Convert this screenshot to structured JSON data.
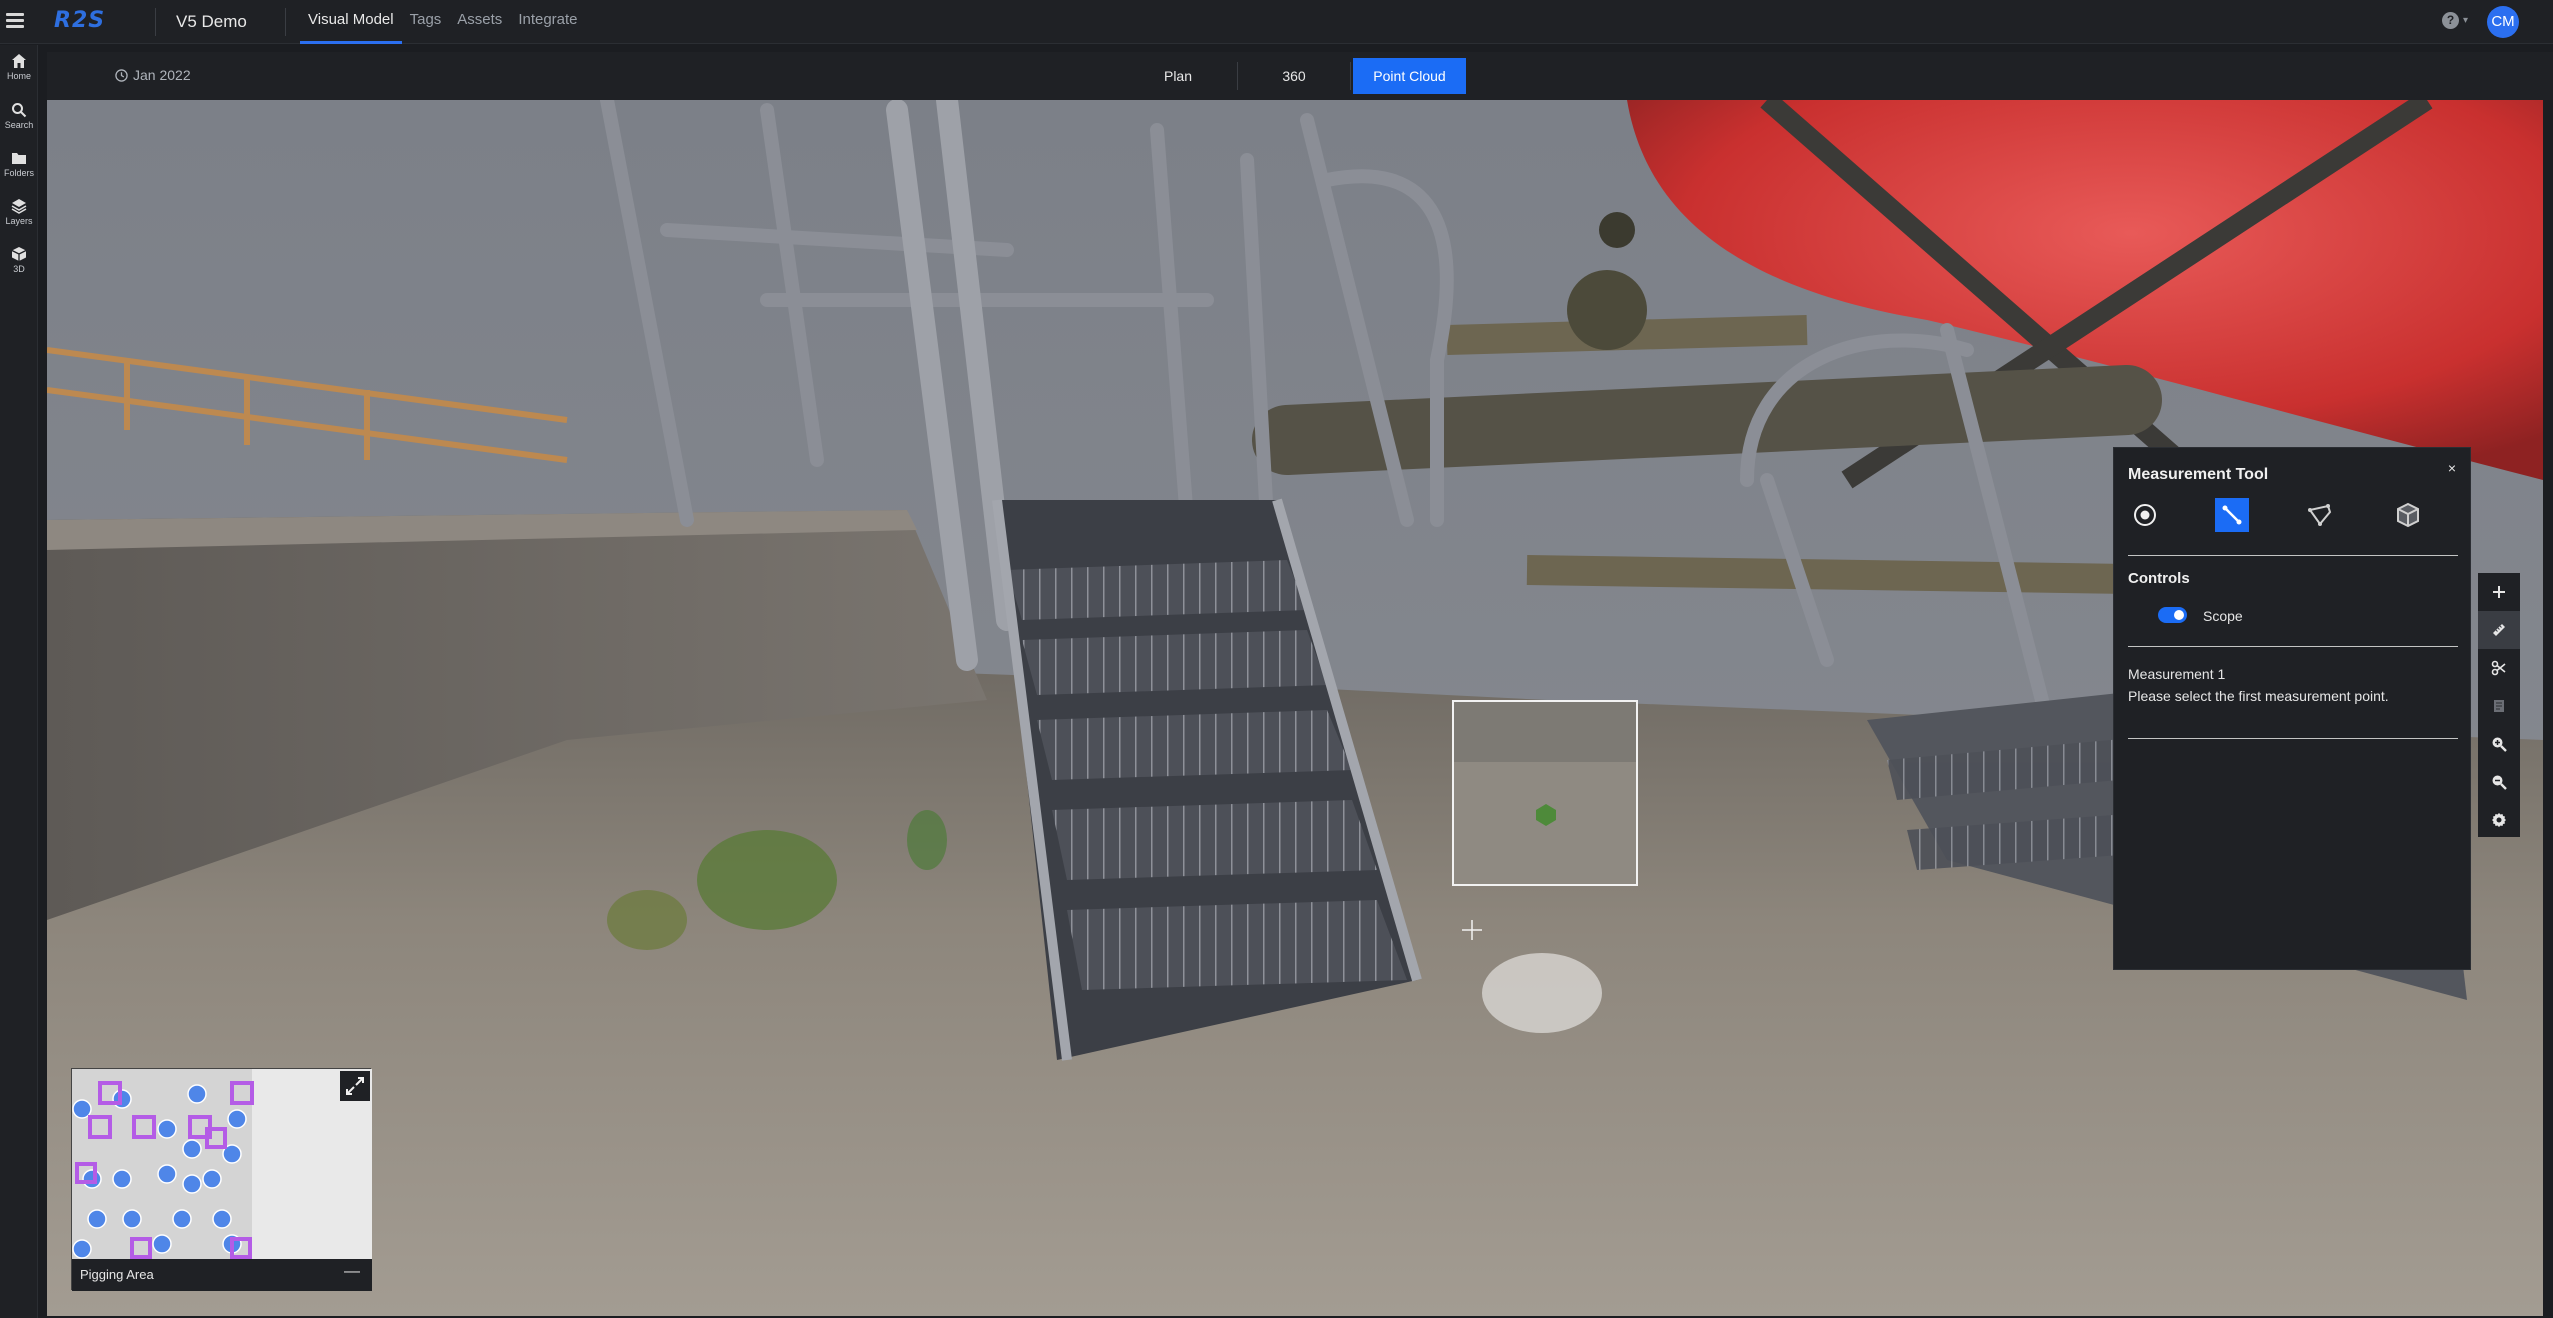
{
  "topbar": {
    "logo": "R2S",
    "project": "V5 Demo",
    "tabs": [
      {
        "label": "Visual Model",
        "active": true
      },
      {
        "label": "Tags",
        "active": false
      },
      {
        "label": "Assets",
        "active": false
      },
      {
        "label": "Integrate",
        "active": false
      }
    ],
    "help": "?",
    "avatar": "CM"
  },
  "sidebar": {
    "items": [
      {
        "label": "Home",
        "icon": "home-icon"
      },
      {
        "label": "Search",
        "icon": "search-icon"
      },
      {
        "label": "Folders",
        "icon": "folder-icon"
      },
      {
        "label": "Layers",
        "icon": "layers-icon"
      },
      {
        "label": "3D",
        "icon": "cube-icon"
      }
    ]
  },
  "subbar": {
    "date": "Jan 2022",
    "views": [
      {
        "label": "Plan",
        "active": false
      },
      {
        "label": "360",
        "active": false
      },
      {
        "label": "Point Cloud",
        "active": true
      }
    ]
  },
  "minimap": {
    "title": "Pigging Area",
    "minimize": "—"
  },
  "measurement_panel": {
    "title": "Measurement Tool",
    "close": "×",
    "tools": [
      "point-tool",
      "distance-tool",
      "area-tool",
      "volume-tool"
    ],
    "active_tool": "distance-tool",
    "controls_heading": "Controls",
    "scope_label": "Scope",
    "scope_enabled": true,
    "measurement_name": "Measurement 1",
    "measurement_hint": "Please select the first measurement point."
  },
  "right_toolbar": {
    "buttons": [
      "plus-icon",
      "ruler-icon",
      "scissors-icon",
      "note-icon",
      "zoom-in-icon",
      "zoom-out-icon",
      "gear-icon"
    ],
    "active": "ruler-icon"
  },
  "colors": {
    "accent": "#1b6cf5",
    "bar": "#1f2125",
    "tank_red": "#d8383a",
    "minimap_marker_blue": "#4f86e8",
    "minimap_marker_purple": "#b45ce6"
  }
}
